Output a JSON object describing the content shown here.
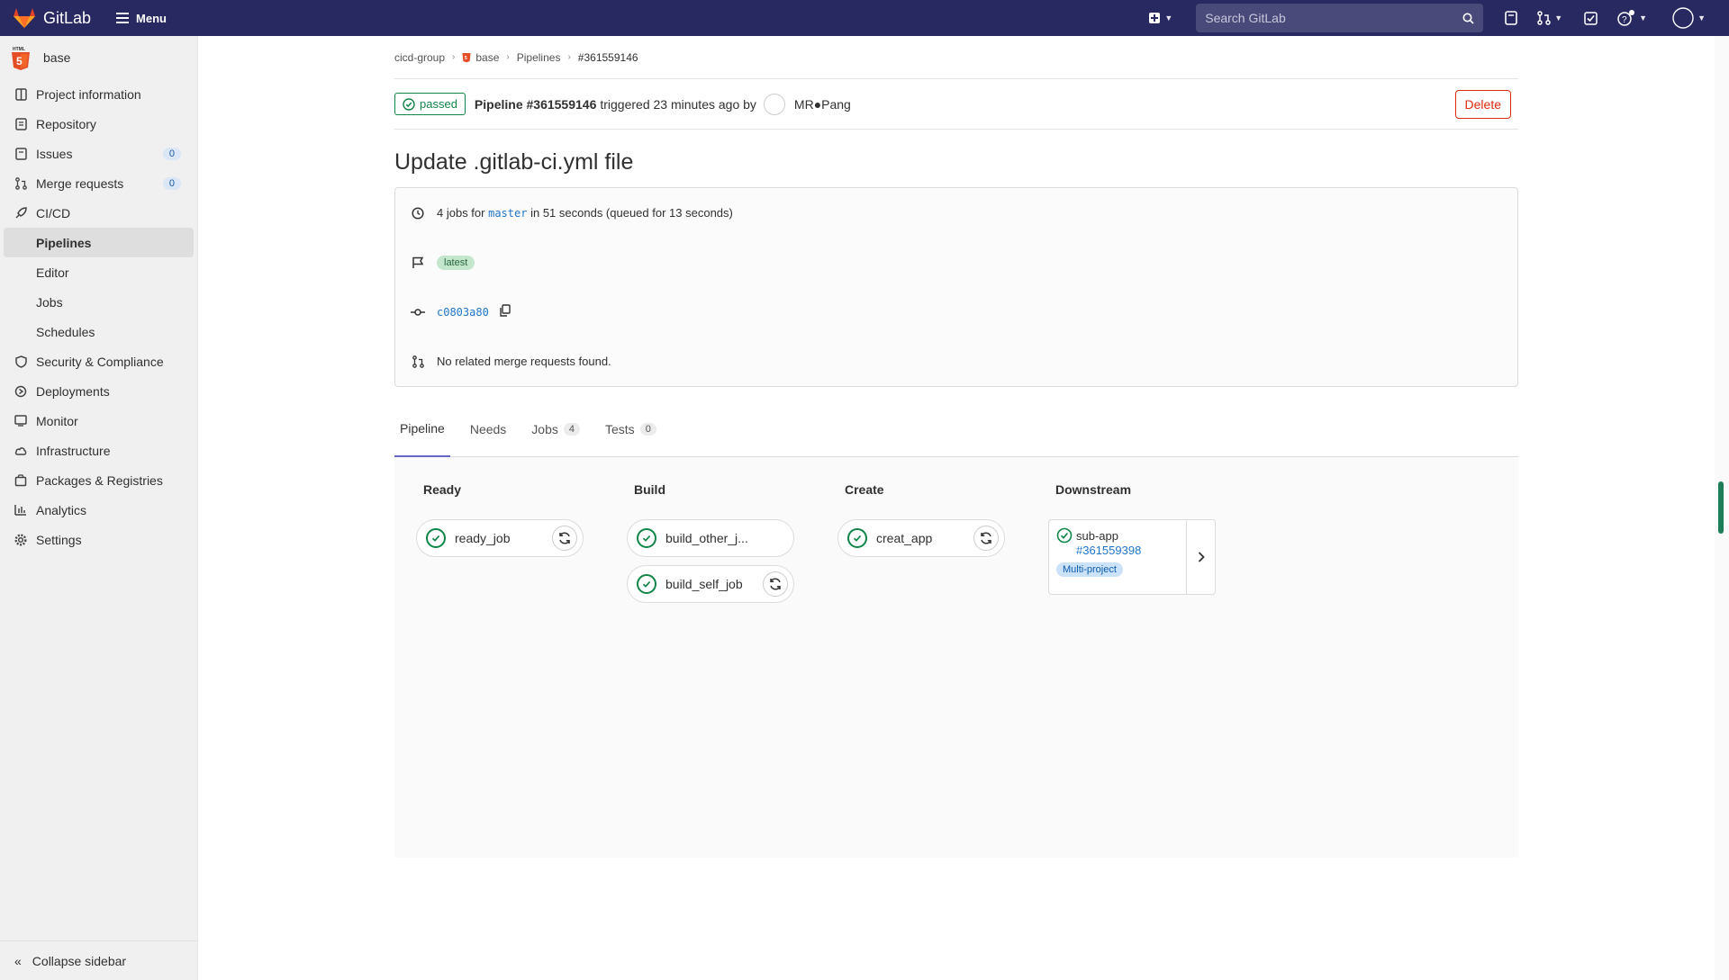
{
  "topbar": {
    "brand": "GitLab",
    "menu_label": "Menu",
    "search_placeholder": "Search GitLab",
    "icons": [
      "plus-square-icon",
      "search-icon",
      "todo-icon",
      "merge-request-icon",
      "issues-icon",
      "help-icon",
      "avatar-icon"
    ]
  },
  "sidebar": {
    "project_name": "base",
    "items": [
      {
        "label": "Project information",
        "icon": "project-icon"
      },
      {
        "label": "Repository",
        "icon": "doc-text-icon"
      },
      {
        "label": "Issues",
        "icon": "issues-icon",
        "count": "0"
      },
      {
        "label": "Merge requests",
        "icon": "git-merge-icon",
        "count": "0"
      },
      {
        "label": "CI/CD",
        "icon": "rocket-icon"
      }
    ],
    "cicd_sub": [
      "Pipelines",
      "Editor",
      "Jobs",
      "Schedules"
    ],
    "items_after": [
      {
        "label": "Security & Compliance",
        "icon": "shield-icon"
      },
      {
        "label": "Deployments",
        "icon": "deployments-icon"
      },
      {
        "label": "Monitor",
        "icon": "monitor-icon"
      },
      {
        "label": "Infrastructure",
        "icon": "cloud-icon"
      },
      {
        "label": "Packages & Registries",
        "icon": "package-icon"
      },
      {
        "label": "Analytics",
        "icon": "chart-icon"
      },
      {
        "label": "Settings",
        "icon": "settings-icon"
      }
    ],
    "collapse_label": "Collapse sidebar"
  },
  "breadcrumb": [
    "cicd-group",
    "base",
    "Pipelines",
    "#361559146"
  ],
  "pipeline": {
    "status": "passed",
    "title_bold": "Pipeline #361559146",
    "triggered_text": "triggered 23 minutes ago by",
    "user": "MR●Pang",
    "delete_label": "Delete"
  },
  "page_title": "Update .gitlab-ci.yml file",
  "info": {
    "jobs_prefix": "4 jobs for",
    "branch": "master",
    "jobs_suffix": "in 51 seconds (queued for 13 seconds)",
    "latest_badge": "latest",
    "commit_sha": "c0803a80",
    "no_mr": "No related merge requests found."
  },
  "tabs": [
    {
      "label": "Pipeline"
    },
    {
      "label": "Needs"
    },
    {
      "label": "Jobs",
      "count": "4"
    },
    {
      "label": "Tests",
      "count": "0"
    }
  ],
  "stages": [
    {
      "name": "Ready",
      "jobs": [
        "ready_job"
      ]
    },
    {
      "name": "Build",
      "jobs": [
        "build_other_j...",
        "build_self_job"
      ]
    },
    {
      "name": "Create",
      "jobs": [
        "creat_app"
      ]
    },
    {
      "name": "Downstream",
      "downstream": {
        "name": "sub-app",
        "id": "#361559398",
        "badge": "Multi-project"
      }
    }
  ]
}
